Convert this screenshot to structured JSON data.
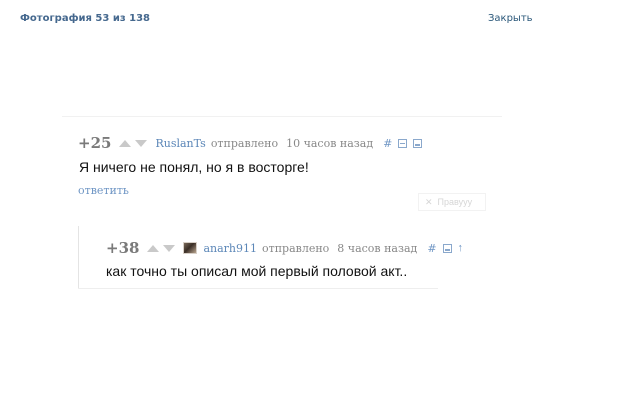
{
  "header": {
    "photo_counter": "Фотография 53 из 138",
    "close_label": "Закрыть"
  },
  "comments": [
    {
      "score": "+25",
      "username": "RuslanTs",
      "sent_label": "отправлено",
      "time": "10 часов назад",
      "hash": "#",
      "text": "Я ничего не понял, но я в восторге!",
      "reply_label": "ответить"
    },
    {
      "score": "+38",
      "username": "anarh911",
      "sent_label": "отправлено",
      "time": "8 часов назад",
      "hash": "#",
      "text": "как точно ты описал мой первый половой акт..",
      "parent_arrow": "↑"
    }
  ],
  "faded_button": {
    "label": "Правууу",
    "icon": "close-icon"
  },
  "colors": {
    "link": "#5c87b8",
    "header": "#45688e",
    "score": "#7a7a7a"
  }
}
